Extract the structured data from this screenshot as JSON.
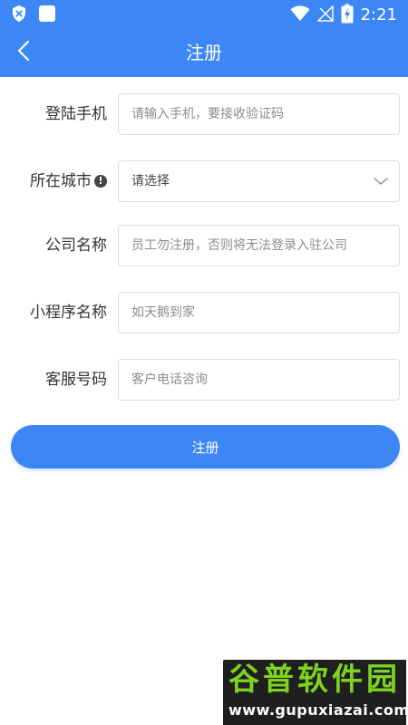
{
  "status_bar": {
    "time": "2:21",
    "icons": [
      "shield-icon",
      "app-square-icon",
      "wifi-icon",
      "no-signal-icon",
      "battery-charging-icon"
    ]
  },
  "nav": {
    "title": "注册",
    "back_icon": "chevron-left-icon"
  },
  "form": {
    "phone": {
      "label": "登陆手机",
      "value": "",
      "placeholder": "请输入手机，要接收验证码"
    },
    "city": {
      "label": "所在城市",
      "selected": "请选择",
      "info_icon": "info-circle-icon"
    },
    "company": {
      "label": "公司名称",
      "value": "",
      "placeholder": "员工勿注册，否则将无法登录入驻公司"
    },
    "miniapp": {
      "label": "小程序名称",
      "value": "",
      "placeholder": "如天鹅到家"
    },
    "service": {
      "label": "客服号码",
      "value": "",
      "placeholder": "客户电话咨询"
    }
  },
  "submit": {
    "label": "注册"
  },
  "watermark": {
    "title": "谷普软件园",
    "url": "www.gupuxiazai.com"
  },
  "colors": {
    "primary": "#3D87F5",
    "watermark_green": "#7ED321"
  }
}
